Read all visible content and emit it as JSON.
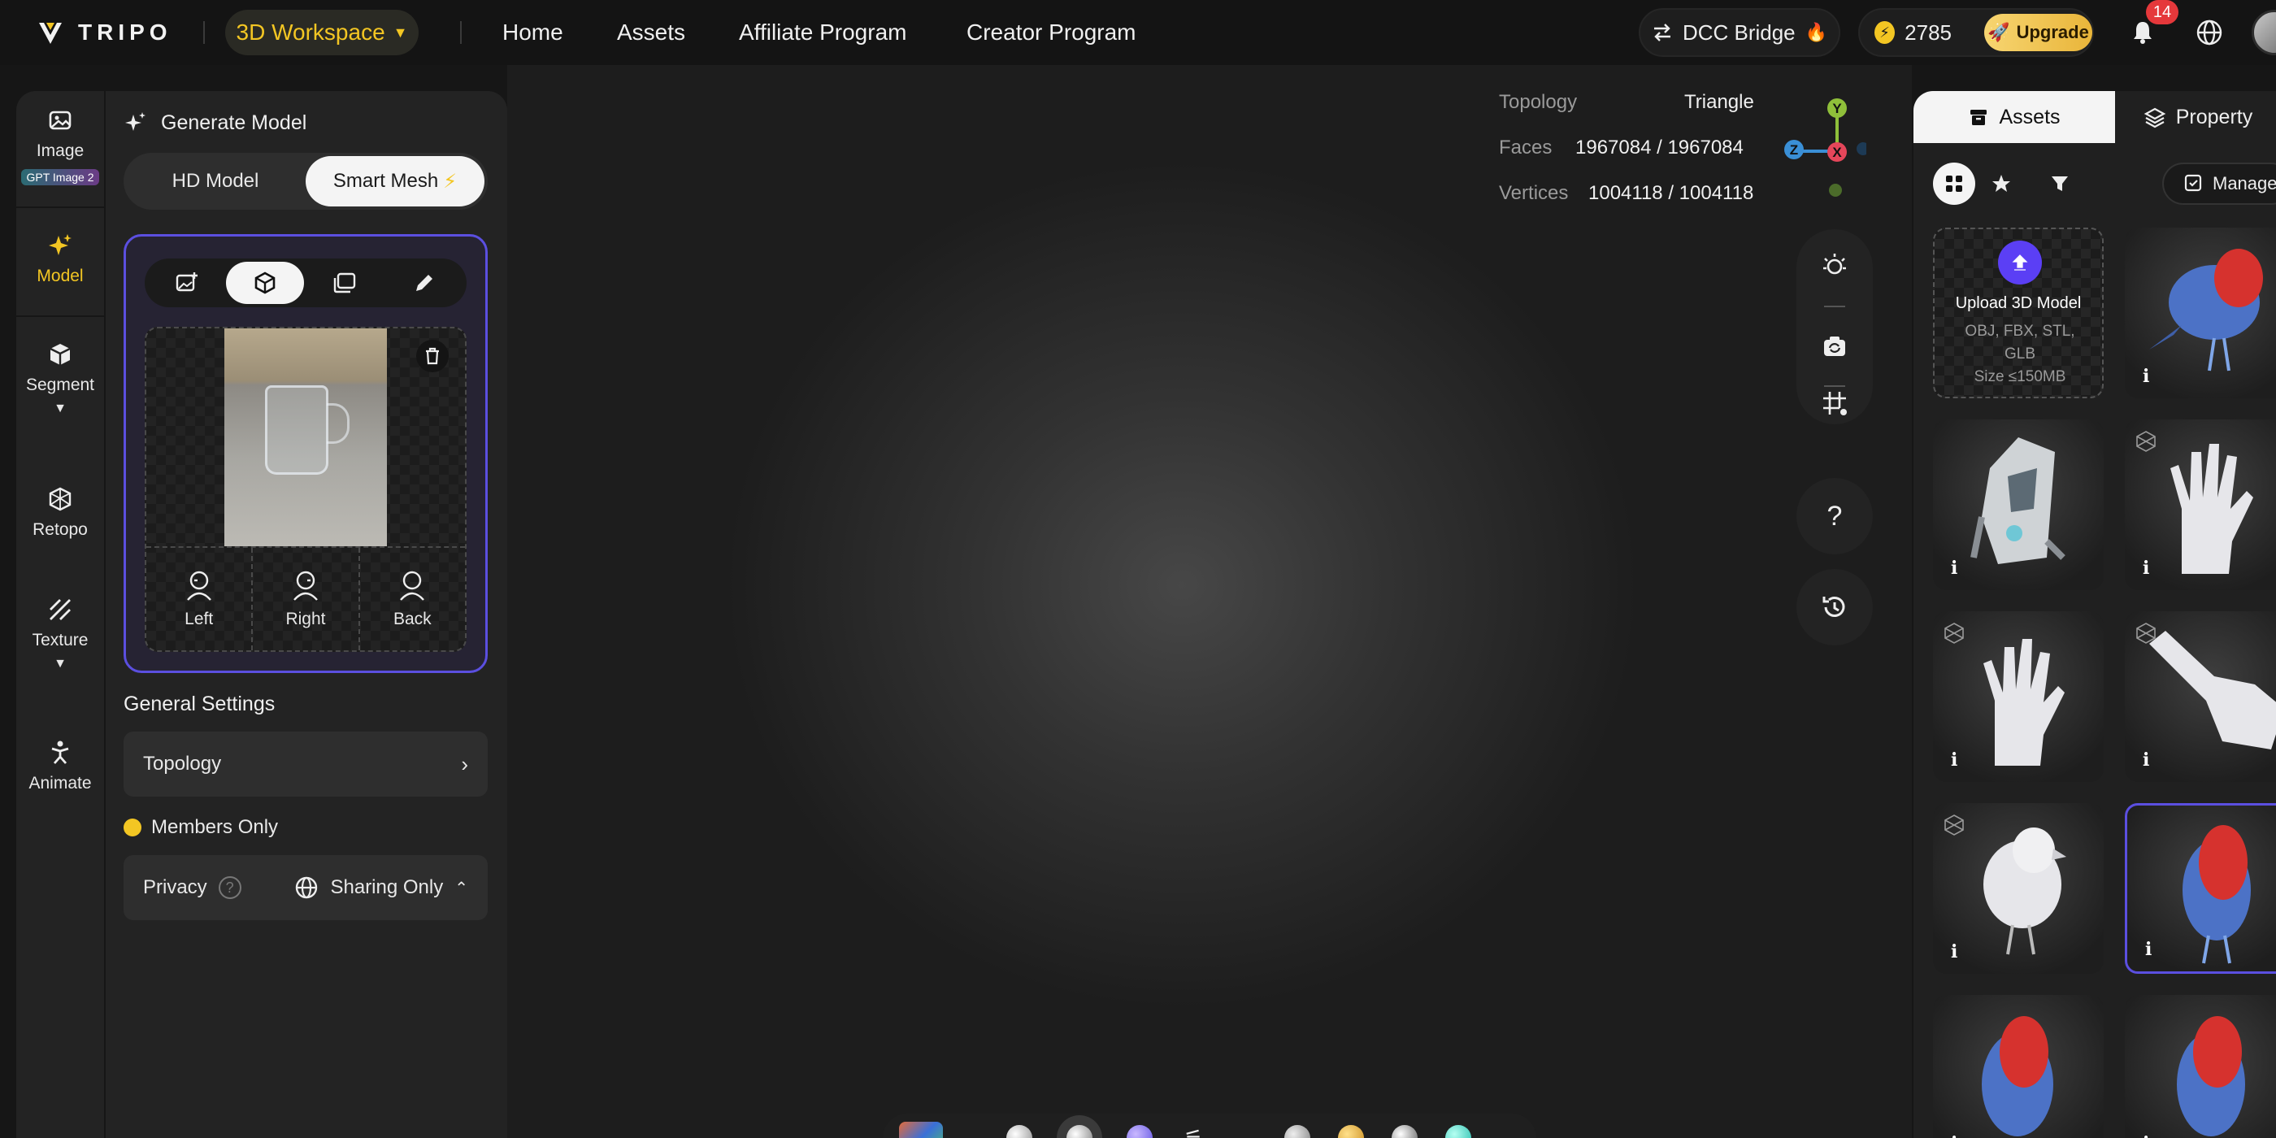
{
  "brand": {
    "name": "TRIPO"
  },
  "workspace": {
    "label": "3D Workspace"
  },
  "nav": {
    "items": [
      "Home",
      "Assets",
      "Affiliate Program",
      "Creator Program"
    ]
  },
  "header": {
    "dcc_label": "DCC Bridge",
    "credits": "2785",
    "upgrade_label": "Upgrade",
    "notification_count": "14"
  },
  "rail": {
    "image": "Image",
    "image_tag": "GPT Image 2",
    "model": "Model",
    "segment": "Segment",
    "retopo": "Retopo",
    "texture": "Texture",
    "animate": "Animate"
  },
  "panel": {
    "title": "Generate Model",
    "hd_label": "HD Model",
    "smart_label": "Smart Mesh",
    "views": [
      "Left",
      "Right",
      "Back"
    ],
    "general_settings": "General Settings",
    "topology_label": "Topology",
    "members_only": "Members Only",
    "privacy_label": "Privacy",
    "privacy_value": "Sharing Only"
  },
  "viewport": {
    "topology_label": "Topology",
    "topology_value": "Triangle",
    "faces_label": "Faces",
    "faces_value": "1967084 / 1967084",
    "vertices_label": "Vertices",
    "vertices_value": "1004118 / 1004118",
    "axes": {
      "y": "Y",
      "z": "Z",
      "x": "X"
    },
    "help_glyph": "?"
  },
  "right": {
    "assets_tab": "Assets",
    "property_tab": "Property",
    "manage_label": "Manage",
    "upload_title": "Upload 3D Model",
    "upload_formats": "OBJ, FBX, STL, GLB",
    "upload_size": "Size ≤150MB",
    "info_glyph": "i"
  },
  "colors": {
    "accent_yellow": "#f3c623",
    "accent_purple": "#5b4fe0",
    "background": "#161616",
    "panel": "#232323"
  }
}
